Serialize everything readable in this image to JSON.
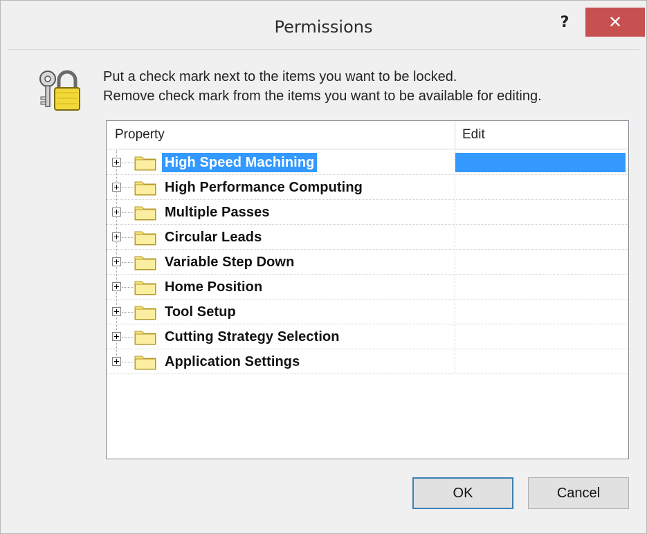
{
  "window": {
    "title": "Permissions",
    "help_label": "?",
    "close_label": "✕"
  },
  "message": {
    "line1": "Put a check mark next to the items you want to be locked.",
    "line2": "Remove check mark from the items you want to be available for editing."
  },
  "table": {
    "columns": [
      "Property",
      "Edit"
    ],
    "rows": [
      {
        "label": "High Speed Machining",
        "selected": true
      },
      {
        "label": "High Performance Computing",
        "selected": false
      },
      {
        "label": "Multiple Passes",
        "selected": false
      },
      {
        "label": "Circular Leads",
        "selected": false
      },
      {
        "label": "Variable Step Down",
        "selected": false
      },
      {
        "label": "Home Position",
        "selected": false
      },
      {
        "label": "Tool Setup",
        "selected": false
      },
      {
        "label": "Cutting Strategy Selection",
        "selected": false
      },
      {
        "label": "Application Settings",
        "selected": false
      }
    ]
  },
  "buttons": {
    "ok": "OK",
    "cancel": "Cancel"
  },
  "colors": {
    "selection": "#3399ff",
    "close_button": "#c75050",
    "folder": "#f5e27a"
  }
}
